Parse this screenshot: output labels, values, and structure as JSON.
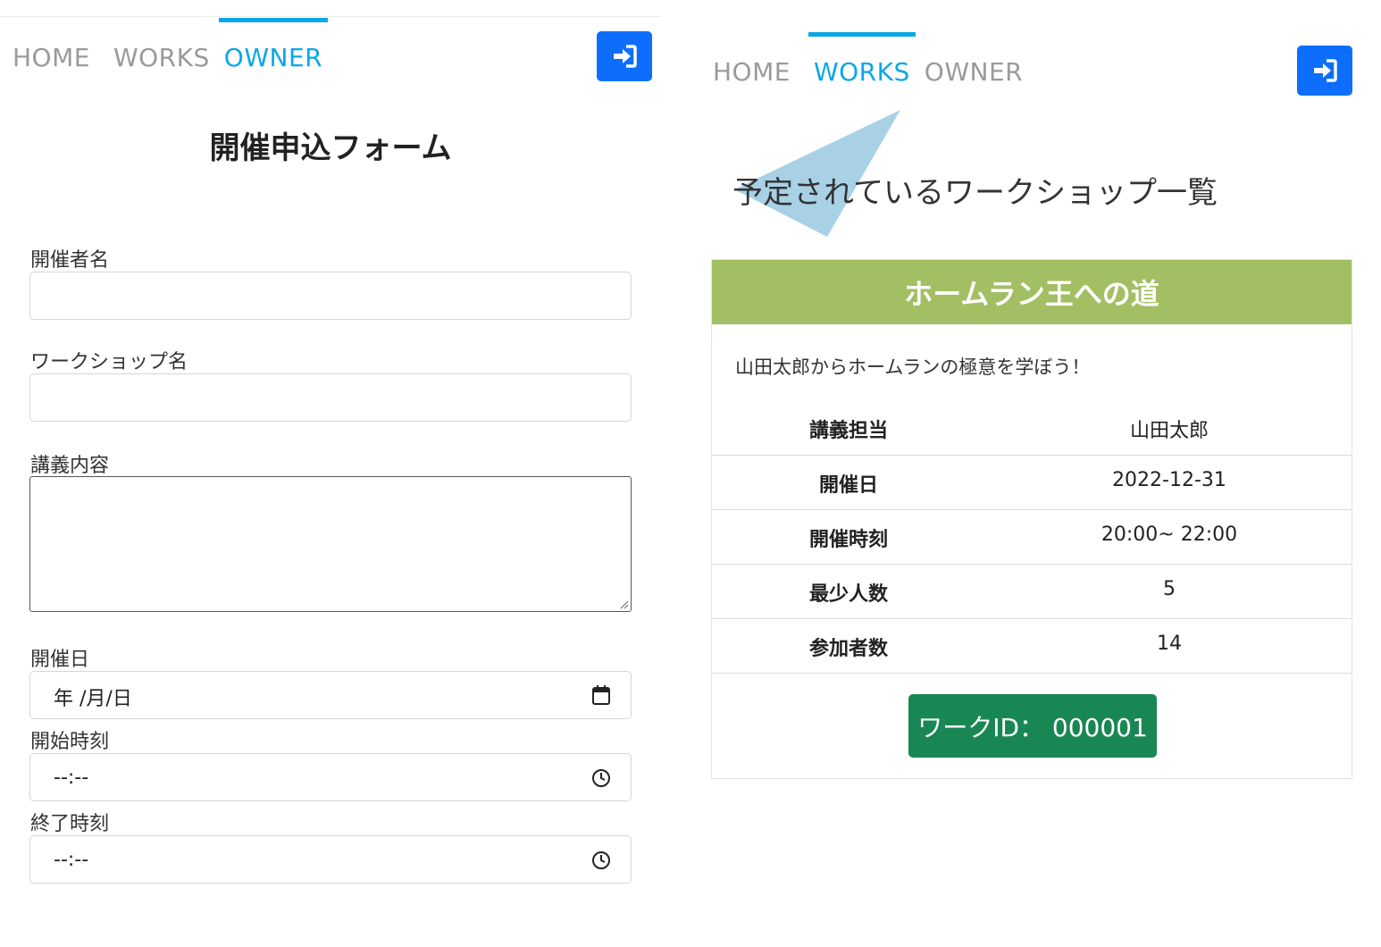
{
  "left": {
    "nav": {
      "home": "HOME",
      "works": "WORKS",
      "owner": "OWNER",
      "active": "owner"
    },
    "form_title": "開催申込フォーム",
    "fields": {
      "organizer_label": "開催者名",
      "workshop_label": "ワークショップ名",
      "content_label": "講義内容",
      "date_label": "開催日",
      "date_placeholder": "年 /月/日",
      "start_label": "開始時刻",
      "start_placeholder": "--:--",
      "end_label": "終了時刻",
      "end_placeholder": "--:--"
    }
  },
  "right": {
    "nav": {
      "home": "HOME",
      "works": "WORKS",
      "owner": "OWNER",
      "active": "works"
    },
    "list_title": "予定されているワークショップ一覧",
    "card": {
      "title": "ホームラン王への道",
      "description": "山田太郎からホームランの極意を学ぼう！",
      "rows": [
        {
          "key": "講義担当",
          "value": "山田太郎"
        },
        {
          "key": "開催日",
          "value": "2022-12-31"
        },
        {
          "key": "開催時刻",
          "value": "20:00~ 22:00"
        },
        {
          "key": "最少人数",
          "value": "5"
        },
        {
          "key": "参加者数",
          "value": "14"
        }
      ],
      "work_id_label": "ワークID： 000001"
    }
  },
  "colors": {
    "nav_active": "#0aa7e6",
    "nav_inactive": "#9a9a9a",
    "login_button": "#0d6efd",
    "card_header": "#a3bf64",
    "work_id_button": "#198754",
    "annotation_triangle": "#a8d1e6"
  },
  "icons": {
    "login": "sign-in-icon",
    "calendar": "calendar-icon",
    "clock": "clock-icon"
  }
}
